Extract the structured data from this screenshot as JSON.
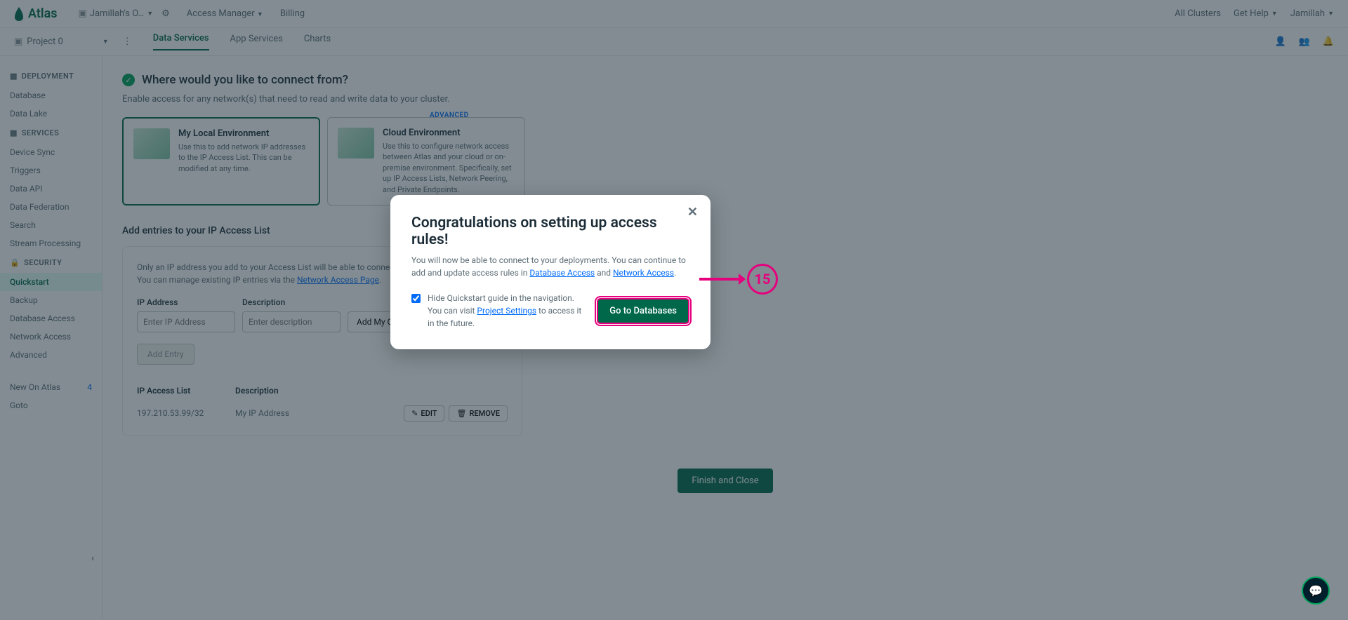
{
  "topbar": {
    "logo": "Atlas",
    "org": "Jamillah's O…",
    "nav": {
      "access_manager": "Access Manager",
      "billing": "Billing"
    },
    "right": {
      "all_clusters": "All Clusters",
      "get_help": "Get Help",
      "user": "Jamillah"
    }
  },
  "subbar": {
    "project": "Project 0",
    "tabs": {
      "data_services": "Data Services",
      "app_services": "App Services",
      "charts": "Charts"
    }
  },
  "sidebar": {
    "deployment_head": "DEPLOYMENT",
    "database": "Database",
    "data_lake": "Data Lake",
    "services_head": "SERVICES",
    "device_sync": "Device Sync",
    "triggers": "Triggers",
    "data_api": "Data API",
    "data_federation": "Data Federation",
    "search": "Search",
    "stream_processing": "Stream Processing",
    "security_head": "SECURITY",
    "quickstart": "Quickstart",
    "backup": "Backup",
    "database_access": "Database Access",
    "network_access": "Network Access",
    "advanced": "Advanced",
    "new_on_atlas": "New On Atlas",
    "new_count": "4",
    "goto": "Goto"
  },
  "content": {
    "question": "Where would you like to connect from?",
    "subtext": "Enable access for any network(s) that need to read and write data to your cluster.",
    "adv_badge": "ADVANCED",
    "env1": {
      "title": "My Local Environment",
      "desc": "Use this to add network IP addresses to the IP Access List. This can be modified at any time."
    },
    "env2": {
      "title": "Cloud Environment",
      "desc": "Use this to configure network access between Atlas and your cloud or on-premise environment. Specifically, set up IP Access Lists, Network Peering, and Private Endpoints."
    },
    "add_entries_title": "Add entries to your IP Access List",
    "hint_prefix": "Only an IP address you add to your Access List will be able to connect to your project's clusters. You can manage existing IP entries via the ",
    "hint_link": "Network Access Page",
    "ip_label": "IP Address",
    "ip_placeholder": "Enter IP Address",
    "desc_label": "Description",
    "desc_placeholder": "Enter description",
    "add_current": "Add My Current IP Address",
    "add_entry": "Add Entry",
    "list_head1": "IP Access List",
    "list_head2": "Description",
    "row_ip": "197.210.53.99/32",
    "row_desc": "My IP Address",
    "edit": "EDIT",
    "remove": "REMOVE",
    "finish": "Finish and Close"
  },
  "modal": {
    "title": "Congratulations on setting up access rules!",
    "body_prefix": "You will now be able to connect to your deployments. You can continue to add and update access rules in ",
    "link1": "Database Access",
    "and": " and ",
    "link2": "Network Access",
    "period": ".",
    "chk_prefix": "Hide Quickstart guide in the navigation. You can visit ",
    "chk_link": "Project Settings",
    "chk_suffix": " to access it in the future.",
    "go": "Go to Databases"
  },
  "annotation": {
    "num": "15"
  }
}
